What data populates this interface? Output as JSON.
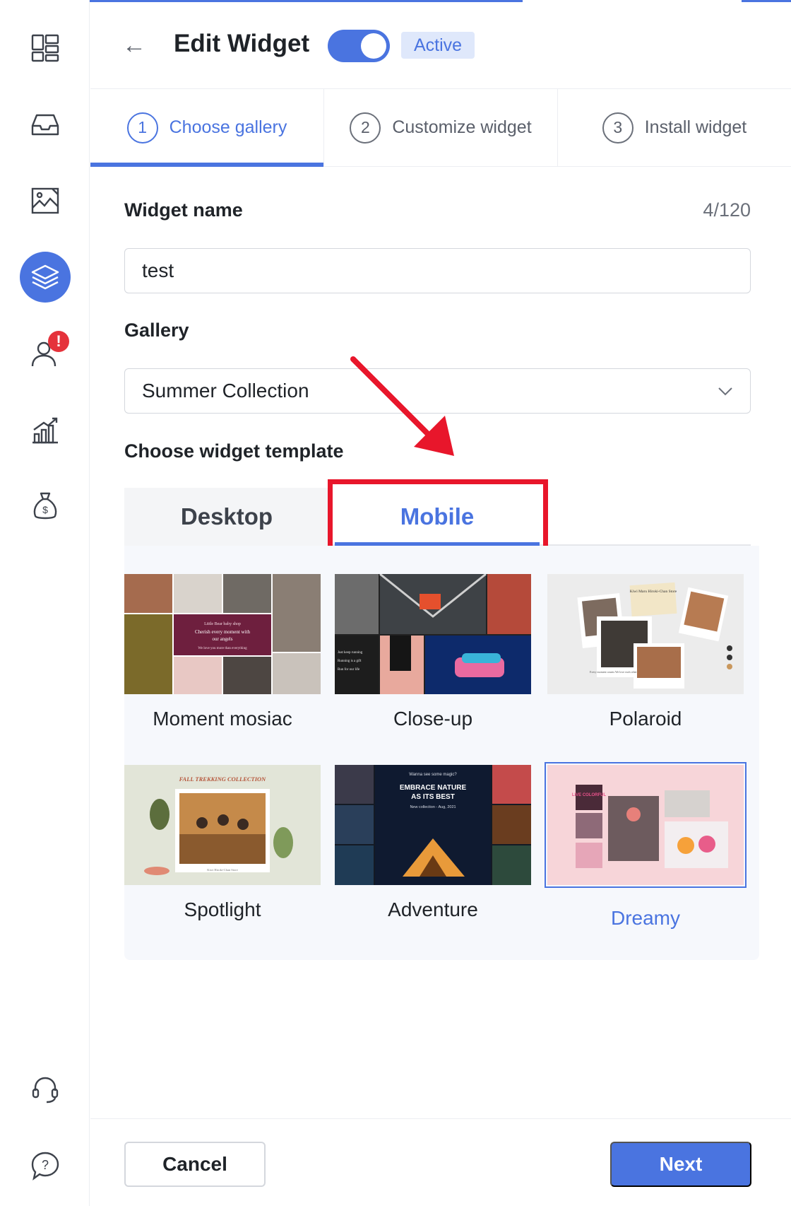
{
  "header": {
    "title": "Edit Widget",
    "back_icon": "arrow-left-icon",
    "toggle_on": true,
    "status": "Active"
  },
  "sidebar": {
    "items": [
      {
        "icon": "dashboard-icon"
      },
      {
        "icon": "inbox-icon"
      },
      {
        "icon": "image-gallery-icon"
      },
      {
        "icon": "layers-icon",
        "active": true
      },
      {
        "icon": "user-icon",
        "badge": "!"
      },
      {
        "icon": "analytics-icon"
      },
      {
        "icon": "money-bag-icon"
      },
      {
        "icon": "support-headset-icon"
      },
      {
        "icon": "help-icon"
      }
    ]
  },
  "steps": [
    {
      "num": "1",
      "label": "Choose gallery",
      "active": true
    },
    {
      "num": "2",
      "label": "Customize widget"
    },
    {
      "num": "3",
      "label": "Install widget"
    }
  ],
  "form": {
    "name_label": "Widget name",
    "name_counter": "4/120",
    "name_value": "test",
    "gallery_label": "Gallery",
    "gallery_value": "Summer Collection",
    "template_label": "Choose widget template"
  },
  "tabs": {
    "desktop": "Desktop",
    "mobile": "Mobile",
    "selected": "Mobile"
  },
  "templates": [
    {
      "name": "Moment mosiac"
    },
    {
      "name": "Close-up"
    },
    {
      "name": "Polaroid"
    },
    {
      "name": "Spotlight"
    },
    {
      "name": "Adventure"
    },
    {
      "name": "Dreamy",
      "selected": true
    }
  ],
  "thumb_text": {
    "moment": {
      "line1": "Little Bear baby shop",
      "line2": "Cherish every moment with",
      "line3": "our angels",
      "line4": "We love you more than everything"
    },
    "closeup": {
      "line1": "Just keep running",
      "line2": "Running is a gift",
      "line3": "Run for our life"
    },
    "polaroid": {
      "note": "Kiwi Maru Hiroki-Chan Store",
      "caption": "Every moment counts We love each other"
    },
    "spotlight": {
      "title": "FALL TREKKING COLLECTION",
      "footer": "Kiwi Hiroki-Chan Store"
    },
    "adventure": {
      "top": "Wanna see some magic?",
      "title1": "EMBRACE NATURE",
      "title2": "AS ITS BEST",
      "sub": "New collection - Aug, 2021"
    },
    "dreamy": {
      "tag": "LIVE COLORFUL"
    }
  },
  "footer": {
    "cancel": "Cancel",
    "next": "Next"
  },
  "colors": {
    "accent": "#4a74e0",
    "highlight": "#e8162b",
    "badge": "#e5323b"
  }
}
